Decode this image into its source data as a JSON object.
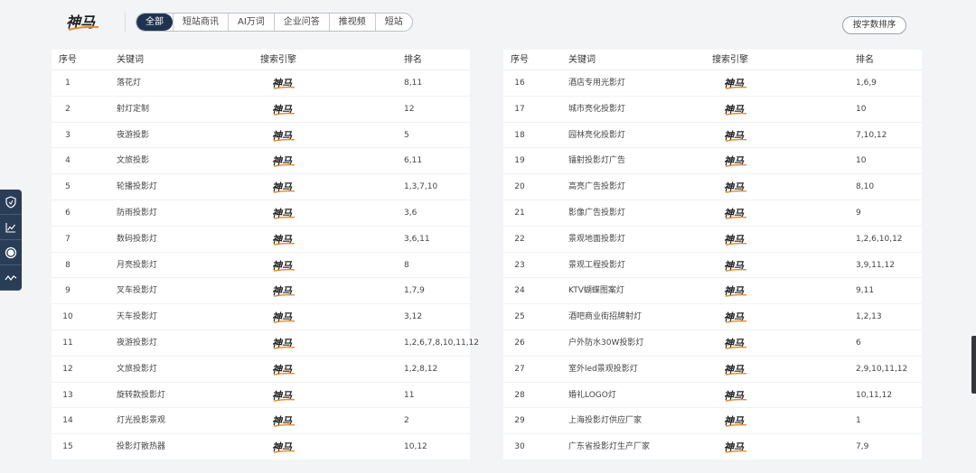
{
  "brand": {
    "logo_text": "神马"
  },
  "tabs": [
    {
      "label": "全部",
      "active": true
    },
    {
      "label": "短站商讯",
      "active": false
    },
    {
      "label": "AI万词",
      "active": false
    },
    {
      "label": "企业问答",
      "active": false
    },
    {
      "label": "推视频",
      "active": false
    },
    {
      "label": "短站",
      "active": false
    }
  ],
  "sort_button": "按字数排序",
  "table_headers": {
    "no": "序号",
    "keyword": "关键词",
    "engine": "搜索引擎",
    "rank": "排名"
  },
  "engine_logo_text": "神马",
  "colors": {
    "accent": "#1f3350",
    "logo_orange": "#e3892f",
    "logo_dark": "#222222",
    "sidebar": "#2a3d57"
  },
  "sidebar": [
    {
      "icon": "shield-icon"
    },
    {
      "icon": "line-chart-icon"
    },
    {
      "icon": "circle-icon"
    },
    {
      "icon": "trend-icon"
    }
  ],
  "left_rows": [
    {
      "no": "1",
      "keyword": "落花灯",
      "rank": "8,11"
    },
    {
      "no": "2",
      "keyword": "射灯定制",
      "rank": "12"
    },
    {
      "no": "3",
      "keyword": "夜游投影",
      "rank": "5"
    },
    {
      "no": "4",
      "keyword": "文旅投影",
      "rank": "6,11"
    },
    {
      "no": "5",
      "keyword": "轮播投影灯",
      "rank": "1,3,7,10"
    },
    {
      "no": "6",
      "keyword": "防雨投影灯",
      "rank": "3,6"
    },
    {
      "no": "7",
      "keyword": "数码投影灯",
      "rank": "3,6,11"
    },
    {
      "no": "8",
      "keyword": "月亮投影灯",
      "rank": "8"
    },
    {
      "no": "9",
      "keyword": "叉车投影灯",
      "rank": "1,7,9"
    },
    {
      "no": "10",
      "keyword": "天车投影灯",
      "rank": "3,12"
    },
    {
      "no": "11",
      "keyword": "夜游投影灯",
      "rank": "1,2,6,7,8,10,11,12"
    },
    {
      "no": "12",
      "keyword": "文旅投影灯",
      "rank": "1,2,8,12"
    },
    {
      "no": "13",
      "keyword": "旋转款投影灯",
      "rank": "11"
    },
    {
      "no": "14",
      "keyword": "灯光投影景观",
      "rank": "2"
    },
    {
      "no": "15",
      "keyword": "投影灯散热器",
      "rank": "10,12"
    }
  ],
  "right_rows": [
    {
      "no": "16",
      "keyword": "酒店专用光影灯",
      "rank": "1,6,9"
    },
    {
      "no": "17",
      "keyword": "城市亮化投影灯",
      "rank": "10"
    },
    {
      "no": "18",
      "keyword": "园林亮化投影灯",
      "rank": "7,10,12"
    },
    {
      "no": "19",
      "keyword": "镭射投影灯广告",
      "rank": "10"
    },
    {
      "no": "20",
      "keyword": "高亮广告投影灯",
      "rank": "8,10"
    },
    {
      "no": "21",
      "keyword": "影像广告投影灯",
      "rank": "9"
    },
    {
      "no": "22",
      "keyword": "景观地面投影灯",
      "rank": "1,2,6,10,12"
    },
    {
      "no": "23",
      "keyword": "景观工程投影灯",
      "rank": "3,9,11,12"
    },
    {
      "no": "24",
      "keyword": "KTV蝴蝶图案灯",
      "rank": "9,11"
    },
    {
      "no": "25",
      "keyword": "酒吧商业街招牌射灯",
      "rank": "1,2,13"
    },
    {
      "no": "26",
      "keyword": "户外防水30W投影灯",
      "rank": "6"
    },
    {
      "no": "27",
      "keyword": "室外led景观投影灯",
      "rank": "2,9,10,11,12"
    },
    {
      "no": "28",
      "keyword": "婚礼LOGO灯",
      "rank": "10,11,12"
    },
    {
      "no": "29",
      "keyword": "上海投影灯供应厂家",
      "rank": "1"
    },
    {
      "no": "30",
      "keyword": "广东省投影灯生产厂家",
      "rank": "7,9"
    }
  ]
}
